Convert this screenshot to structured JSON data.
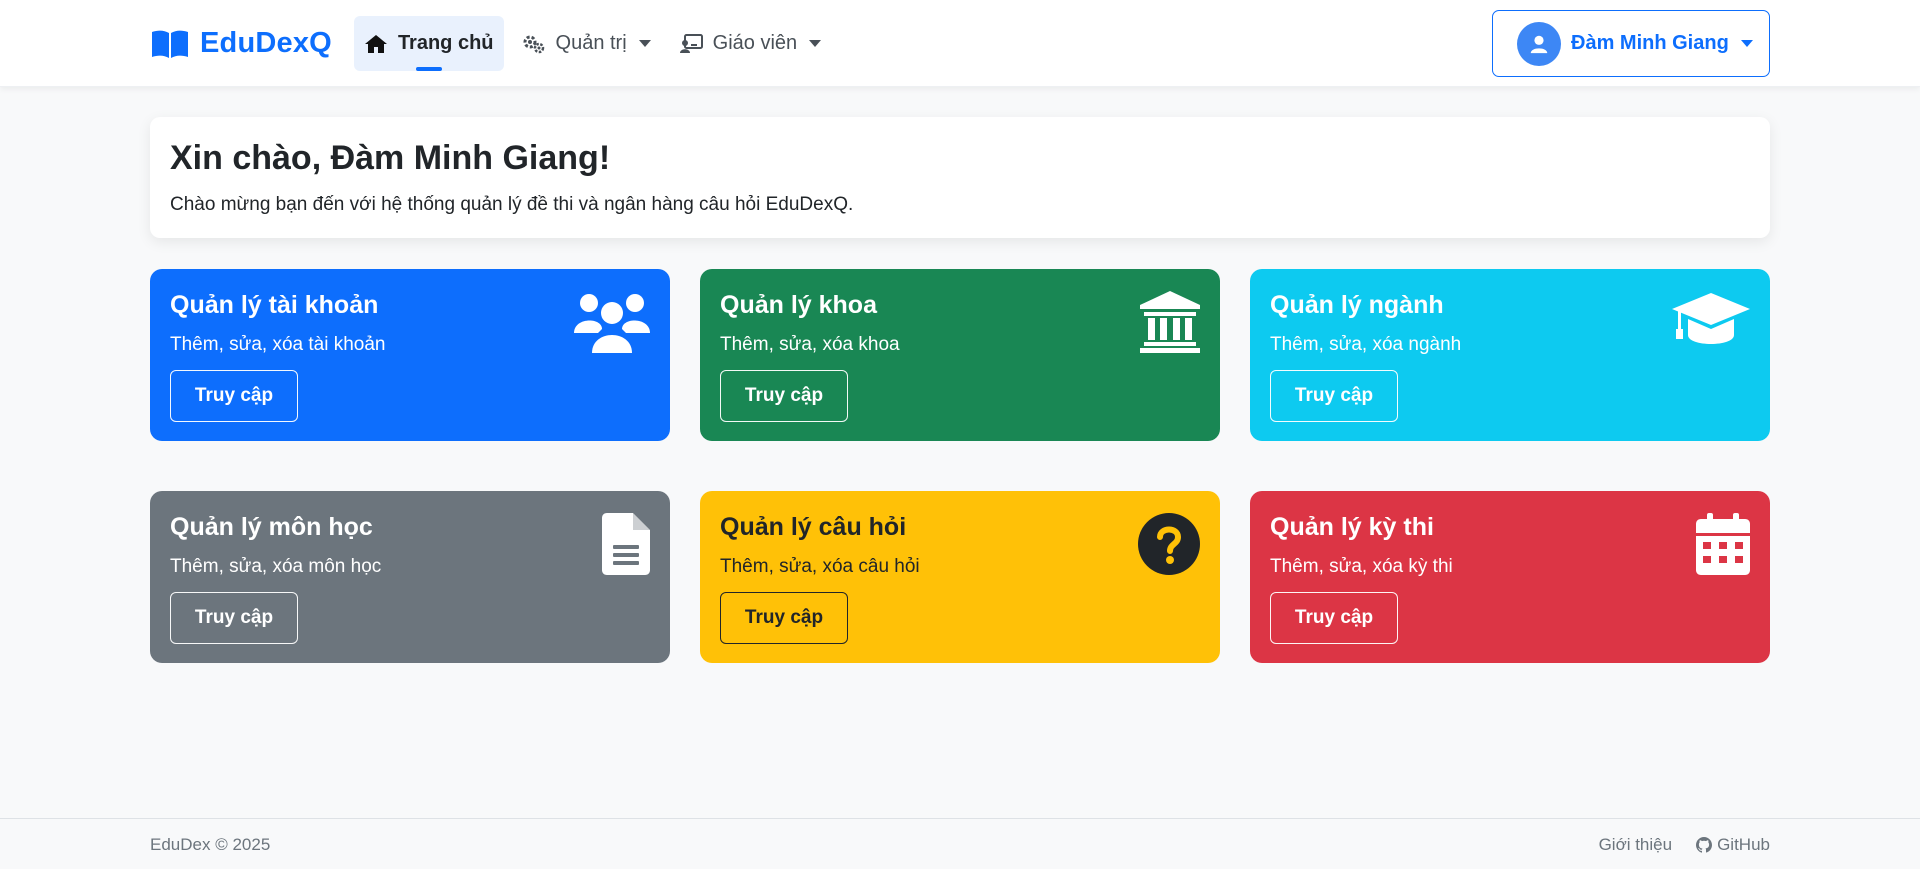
{
  "brand": {
    "name": "EduDexQ",
    "icon": "book-open-icon",
    "color": "#0d6efd"
  },
  "nav": {
    "home": {
      "label": "Trang chủ",
      "icon": "home-icon"
    },
    "admin": {
      "label": "Quản trị",
      "icon": "gears-icon"
    },
    "teacher": {
      "label": "Giáo viên",
      "icon": "chalkboard-teacher-icon"
    }
  },
  "user": {
    "name": "Đàm Minh Giang",
    "icon": "user-icon"
  },
  "welcome": {
    "title": "Xin chào, Đàm Minh Giang!",
    "subtitle": "Chào mừng bạn đến với hệ thống quản lý đề thi và ngân hàng câu hỏi EduDexQ."
  },
  "cards": [
    {
      "title": "Quản lý tài khoản",
      "desc": "Thêm, sửa, xóa tài khoản",
      "button": "Truy cập",
      "icon": "users-icon",
      "color": "#0d6efd"
    },
    {
      "title": "Quản lý khoa",
      "desc": "Thêm, sửa, xóa khoa",
      "button": "Truy cập",
      "icon": "university-icon",
      "color": "#198754"
    },
    {
      "title": "Quản lý ngành",
      "desc": "Thêm, sửa, xóa ngành",
      "button": "Truy cập",
      "icon": "graduation-cap-icon",
      "color": "#0dcaf0"
    },
    {
      "title": "Quản lý môn học",
      "desc": "Thêm, sửa, xóa môn học",
      "button": "Truy cập",
      "icon": "file-alt-icon",
      "color": "#6c757d"
    },
    {
      "title": "Quản lý câu hỏi",
      "desc": "Thêm, sửa, xóa câu hỏi",
      "button": "Truy cập",
      "icon": "question-circle-icon",
      "color": "#ffc107"
    },
    {
      "title": "Quản lý kỳ thi",
      "desc": "Thêm, sửa, xóa kỳ thi",
      "button": "Truy cập",
      "icon": "calendar-icon",
      "color": "#dc3545"
    }
  ],
  "footer": {
    "copyright": "EduDex © 2025",
    "about": "Giới thiệu",
    "github": "GitHub"
  }
}
